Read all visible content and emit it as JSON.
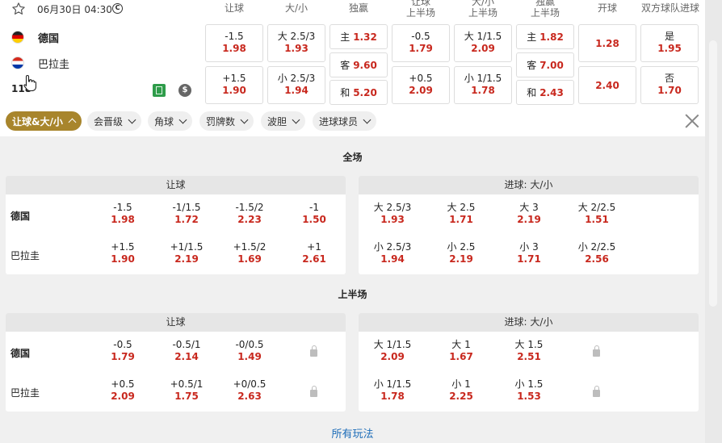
{
  "match": {
    "datetime": "06月30日 04:30",
    "live_symbol": "C",
    "home": "德国",
    "away": "巴拉圭",
    "count": "118",
    "dollar_symbol": "$"
  },
  "columns": {
    "handicap": "让球",
    "totals": "大/小",
    "moneyline": "独赢",
    "handicap_h1_l1": "让球",
    "handicap_h1_l2": "上半场",
    "totals_h1_l1": "大/小",
    "totals_h1_l2": "上半场",
    "moneyline_h1_l1": "独赢",
    "moneyline_h1_l2": "上半场",
    "kickoff": "开球",
    "btts": "双方球队进球"
  },
  "main_odds": {
    "hdp_home": {
      "line": "-1.5",
      "odd": "1.98"
    },
    "hdp_away": {
      "line": "+1.5",
      "odd": "1.90"
    },
    "ou_over": {
      "line": "大 2.5/3",
      "odd": "1.93"
    },
    "ou_under": {
      "line": "小 2.5/3",
      "odd": "1.94"
    },
    "ml_home": {
      "line": "主",
      "odd": "1.32"
    },
    "ml_away": {
      "line": "客",
      "odd": "9.60"
    },
    "ml_draw": {
      "line": "和",
      "odd": "5.20"
    },
    "h1_hdp_home": {
      "line": "-0.5",
      "odd": "1.79"
    },
    "h1_hdp_away": {
      "line": "+0.5",
      "odd": "2.09"
    },
    "h1_ou_over": {
      "line": "大 1/1.5",
      "odd": "2.09"
    },
    "h1_ou_under": {
      "line": "小 1/1.5",
      "odd": "1.78"
    },
    "h1_ml_home": {
      "line": "主",
      "odd": "1.82"
    },
    "h1_ml_away": {
      "line": "客",
      "odd": "7.00"
    },
    "h1_ml_draw": {
      "line": "和",
      "odd": "2.43"
    },
    "kickoff_1": "1.28",
    "kickoff_2": "2.40",
    "btts_yes": {
      "line": "是",
      "odd": "1.95"
    },
    "btts_no": {
      "line": "否",
      "odd": "1.70"
    }
  },
  "filters": [
    {
      "label": "让球&大/小",
      "active": true
    },
    {
      "label": "会晋级"
    },
    {
      "label": "角球"
    },
    {
      "label": "罚牌数"
    },
    {
      "label": "波胆"
    },
    {
      "label": "进球球员"
    }
  ],
  "full_time": {
    "title": "全场",
    "hdp_title": "让球",
    "ou_title": "进球: 大/小",
    "home_label": "德国",
    "away_label": "巴拉圭",
    "hdp_home": [
      {
        "line": "-1.5",
        "odd": "1.98"
      },
      {
        "line": "-1/1.5",
        "odd": "1.72"
      },
      {
        "line": "-1.5/2",
        "odd": "2.23"
      },
      {
        "line": "-1",
        "odd": "1.50"
      }
    ],
    "hdp_away": [
      {
        "line": "+1.5",
        "odd": "1.90"
      },
      {
        "line": "+1/1.5",
        "odd": "2.19"
      },
      {
        "line": "+1.5/2",
        "odd": "1.69"
      },
      {
        "line": "+1",
        "odd": "2.61"
      }
    ],
    "ou_over": [
      {
        "line": "大 2.5/3",
        "odd": "1.93"
      },
      {
        "line": "大 2.5",
        "odd": "1.71"
      },
      {
        "line": "大 3",
        "odd": "2.19"
      },
      {
        "line": "大 2/2.5",
        "odd": "1.51"
      }
    ],
    "ou_under": [
      {
        "line": "小 2.5/3",
        "odd": "1.94"
      },
      {
        "line": "小 2.5",
        "odd": "2.19"
      },
      {
        "line": "小 3",
        "odd": "1.71"
      },
      {
        "line": "小 2/2.5",
        "odd": "2.56"
      }
    ]
  },
  "first_half": {
    "title": "上半场",
    "hdp_title": "让球",
    "ou_title": "进球: 大/小",
    "home_label": "德国",
    "away_label": "巴拉圭",
    "hdp_home": [
      {
        "line": "-0.5",
        "odd": "1.79"
      },
      {
        "line": "-0.5/1",
        "odd": "2.14"
      },
      {
        "line": "-0/0.5",
        "odd": "1.49"
      }
    ],
    "hdp_away": [
      {
        "line": "+0.5",
        "odd": "2.09"
      },
      {
        "line": "+0.5/1",
        "odd": "1.75"
      },
      {
        "line": "+0/0.5",
        "odd": "2.63"
      }
    ],
    "ou_over": [
      {
        "line": "大 1/1.5",
        "odd": "2.09"
      },
      {
        "line": "大 1",
        "odd": "1.67"
      },
      {
        "line": "大 1.5",
        "odd": "2.51"
      }
    ],
    "ou_under": [
      {
        "line": "小 1/1.5",
        "odd": "1.78"
      },
      {
        "line": "小 1",
        "odd": "2.25"
      },
      {
        "line": "小 1.5",
        "odd": "1.53"
      }
    ]
  },
  "all_markets_link": "所有玩法"
}
